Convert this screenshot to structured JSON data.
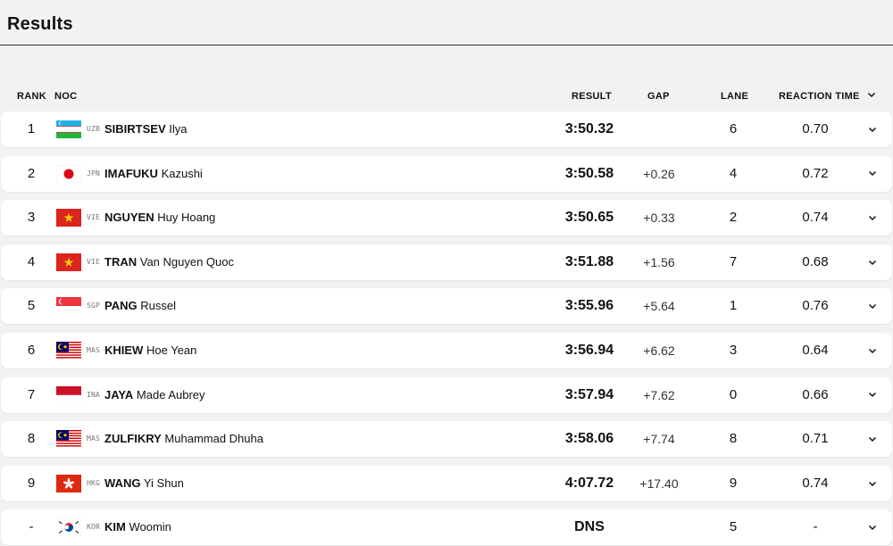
{
  "page": {
    "title": "Results"
  },
  "columns": {
    "rank": "RANK",
    "noc": "NOC",
    "result": "RESULT",
    "gap": "GAP",
    "lane": "LANE",
    "reaction_time": "REACTION TIME"
  },
  "rows": [
    {
      "rank": "1",
      "flag": "uzb-flag",
      "noc": "UZB",
      "last": "SIBIRTSEV",
      "first": "Ilya",
      "result": "3:50.32",
      "gap": "",
      "lane": "6",
      "rt": "0.70"
    },
    {
      "rank": "2",
      "flag": "jpn-flag",
      "noc": "JPN",
      "last": "IMAFUKU",
      "first": "Kazushi",
      "result": "3:50.58",
      "gap": "+0.26",
      "lane": "4",
      "rt": "0.72"
    },
    {
      "rank": "3",
      "flag": "vie-flag",
      "noc": "VIE",
      "last": "NGUYEN",
      "first": "Huy Hoang",
      "result": "3:50.65",
      "gap": "+0.33",
      "lane": "2",
      "rt": "0.74"
    },
    {
      "rank": "4",
      "flag": "vie-flag",
      "noc": "VIE",
      "last": "TRAN",
      "first": "Van Nguyen Quoc",
      "result": "3:51.88",
      "gap": "+1.56",
      "lane": "7",
      "rt": "0.68"
    },
    {
      "rank": "5",
      "flag": "sgp-flag",
      "noc": "SGP",
      "last": "PANG",
      "first": "Russel",
      "result": "3:55.96",
      "gap": "+5.64",
      "lane": "1",
      "rt": "0.76"
    },
    {
      "rank": "6",
      "flag": "mas-flag",
      "noc": "MAS",
      "last": "KHIEW",
      "first": "Hoe Yean",
      "result": "3:56.94",
      "gap": "+6.62",
      "lane": "3",
      "rt": "0.64"
    },
    {
      "rank": "7",
      "flag": "ina-flag",
      "noc": "INA",
      "last": "JAYA",
      "first": "Made Aubrey",
      "result": "3:57.94",
      "gap": "+7.62",
      "lane": "0",
      "rt": "0.66"
    },
    {
      "rank": "8",
      "flag": "mas-flag",
      "noc": "MAS",
      "last": "ZULFIKRY",
      "first": "Muhammad Dhuha",
      "result": "3:58.06",
      "gap": "+7.74",
      "lane": "8",
      "rt": "0.71"
    },
    {
      "rank": "9",
      "flag": "hkg-flag",
      "noc": "HKG",
      "last": "WANG",
      "first": "Yi Shun",
      "result": "4:07.72",
      "gap": "+17.40",
      "lane": "9",
      "rt": "0.74"
    },
    {
      "rank": "-",
      "flag": "kor-flag",
      "noc": "KOR",
      "last": "KIM",
      "first": "Woomin",
      "result": "DNS",
      "gap": "",
      "lane": "5",
      "rt": "-"
    }
  ]
}
